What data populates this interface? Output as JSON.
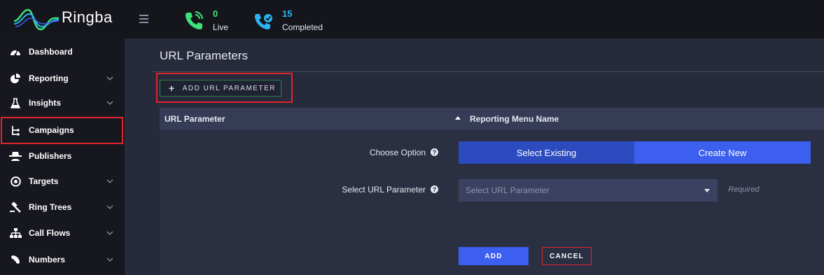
{
  "app": {
    "name": "Ringba"
  },
  "header": {
    "live": {
      "count": "0",
      "label": "Live"
    },
    "completed": {
      "count": "15",
      "label": "Completed"
    }
  },
  "sidebar": {
    "items": [
      {
        "label": "Dashboard",
        "icon": "dashboard-icon",
        "expandable": false
      },
      {
        "label": "Reporting",
        "icon": "pie-chart-icon",
        "expandable": true
      },
      {
        "label": "Insights",
        "icon": "flask-icon",
        "expandable": true
      },
      {
        "label": "Campaigns",
        "icon": "branch-icon",
        "expandable": false,
        "highlighted": true
      },
      {
        "label": "Publishers",
        "icon": "spy-icon",
        "expandable": false
      },
      {
        "label": "Targets",
        "icon": "target-icon",
        "expandable": true
      },
      {
        "label": "Ring Trees",
        "icon": "gavel-icon",
        "expandable": true
      },
      {
        "label": "Call Flows",
        "icon": "sitemap-icon",
        "expandable": true
      },
      {
        "label": "Numbers",
        "icon": "phone-icon",
        "expandable": true
      }
    ]
  },
  "main": {
    "title": "URL Parameters",
    "add_button_label": "ADD URL PARAMETER",
    "table": {
      "columns": [
        "URL Parameter",
        "Reporting Menu Name"
      ]
    },
    "form": {
      "choose_option_label": "Choose Option",
      "options": [
        "Select Existing",
        "Create New"
      ],
      "selected_option": "Select Existing",
      "select_param_label": "Select URL Parameter",
      "select_param_placeholder": "Select URL Parameter",
      "required_text": "Required",
      "add_label": "ADD",
      "cancel_label": "CANCEL"
    }
  },
  "colors": {
    "highlight": "#e0242b",
    "primary": "#3c5ff0",
    "live": "#3de27a",
    "completed": "#2db4f0"
  }
}
